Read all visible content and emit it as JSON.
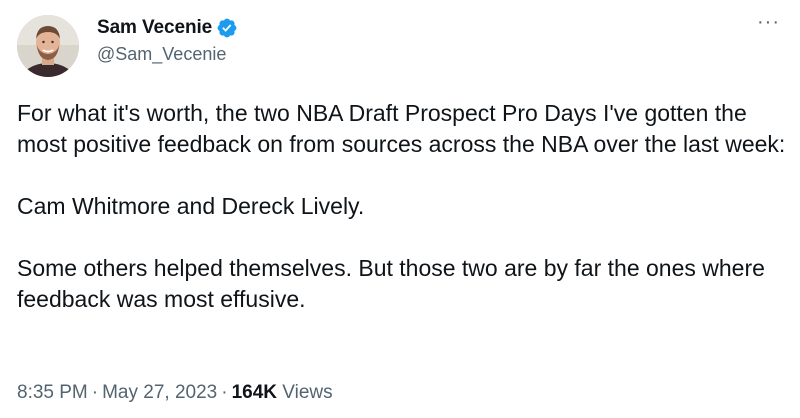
{
  "user": {
    "display_name": "Sam Vecenie",
    "handle": "@Sam_Vecenie",
    "avatar_icon": "profile-photo",
    "verified_icon": "verified-badge-icon",
    "verified_color": "#1d9bf0"
  },
  "more_label": "···",
  "tweet": {
    "paragraphs": [
      "For what it's worth, the two NBA Draft Prospect Pro Days I've gotten the most positive feedback on from sources across the NBA over the last week:",
      "Cam Whitmore and Dereck Lively.",
      "Some others helped themselves. But those two are by far the ones where feedback was most effusive."
    ]
  },
  "meta": {
    "time": "8:35 PM",
    "separator": "·",
    "date": "May 27, 2023",
    "views_count": "164K",
    "views_label": "Views"
  }
}
